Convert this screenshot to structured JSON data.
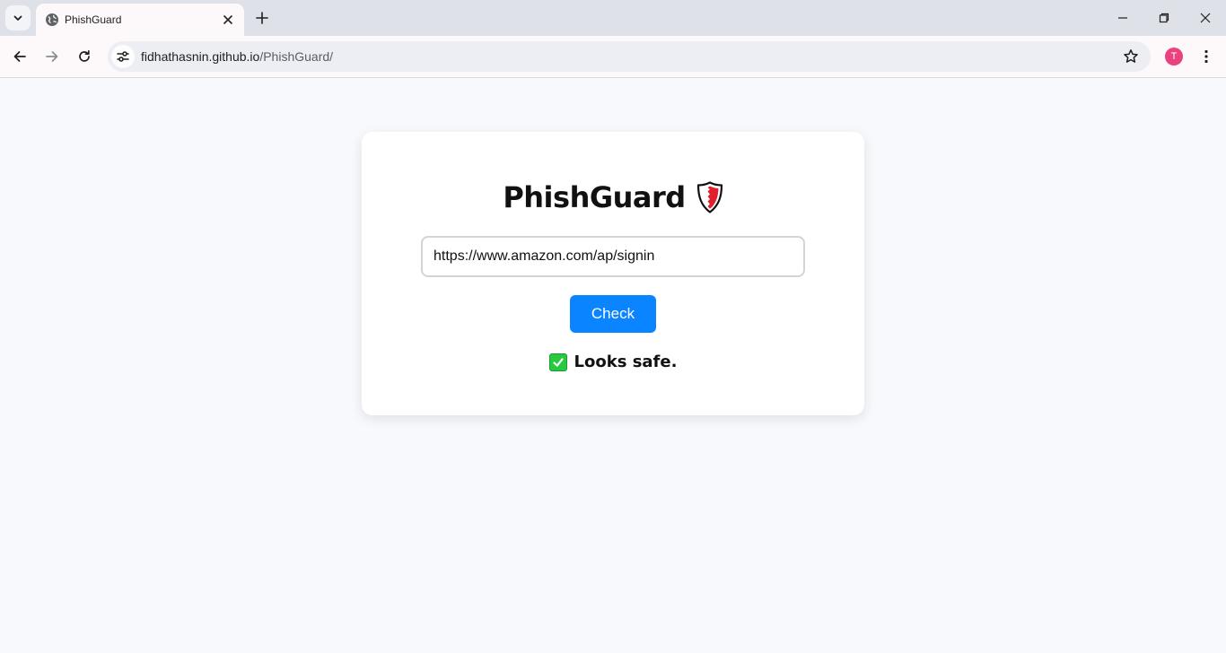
{
  "browser": {
    "tab": {
      "title": "PhishGuard",
      "favicon": "globe-icon"
    },
    "address_bar": {
      "host": "fidhathasnin.github.io",
      "path": "/PhishGuard/"
    },
    "profile_initial": "T",
    "colors": {
      "tabstrip": "#dfe1e8",
      "toolbar": "#fdf8fa",
      "avatar": "#e8437e"
    }
  },
  "app": {
    "title": "PhishGuard",
    "title_icon": "shield-icon",
    "url_input": {
      "value": "https://www.amazon.com/ap/signin"
    },
    "check_button_label": "Check",
    "result": {
      "icon": "green-checkmark-icon",
      "text": "Looks safe."
    },
    "colors": {
      "page_background": "#f8f9fc",
      "button": "#0a84ff",
      "safe": "#27c93f",
      "shield": "#e0202c"
    }
  }
}
